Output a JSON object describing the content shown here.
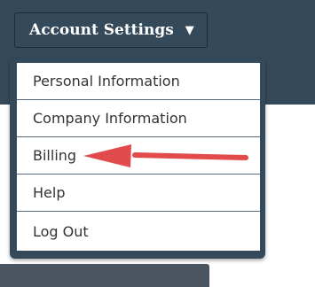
{
  "header": {
    "account_button_label": "Account Settings",
    "account_button_icon": "caret-down-icon"
  },
  "menu": {
    "items": [
      {
        "label": "Personal Information"
      },
      {
        "label": "Company Information"
      },
      {
        "label": "Billing"
      },
      {
        "label": "Help"
      },
      {
        "label": "Log Out"
      }
    ]
  },
  "annotation": {
    "arrow_icon": "left-arrow-icon",
    "arrow_color": "#e24b4b",
    "points_to": "Billing"
  },
  "colors": {
    "header_bg": "#34495a",
    "menu_bg": "#ffffff",
    "text": "#333333"
  }
}
